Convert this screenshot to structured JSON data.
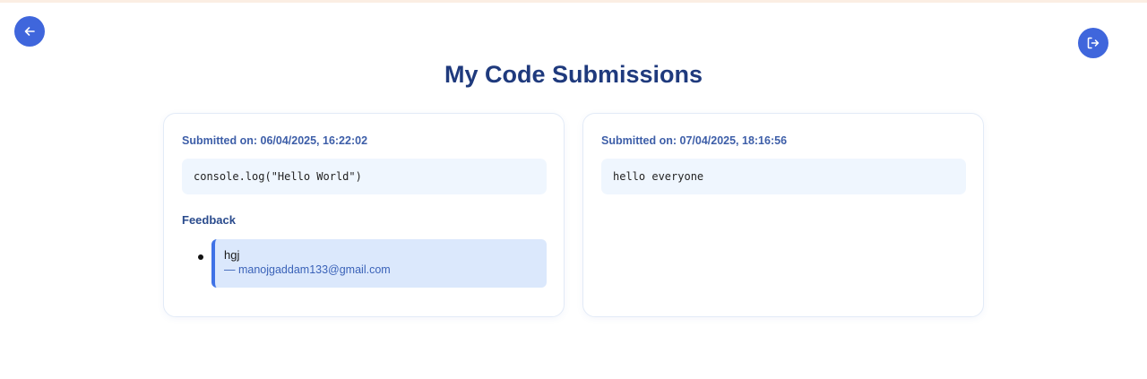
{
  "header": {
    "title": "My Code Submissions",
    "back_icon": "arrow-left-icon",
    "logout_icon": "logout-icon",
    "accent_color": "#3f66dc"
  },
  "submissions": [
    {
      "submitted_label": "Submitted on: 06/04/2025, 16:22:02",
      "code": "console.log(\"Hello World\")",
      "feedback_heading": "Feedback",
      "feedback": [
        {
          "text": "hgj",
          "author": "— manojgaddam133@gmail.com"
        }
      ]
    },
    {
      "submitted_label": "Submitted on: 07/04/2025, 18:16:56",
      "code": "hello everyone"
    }
  ]
}
